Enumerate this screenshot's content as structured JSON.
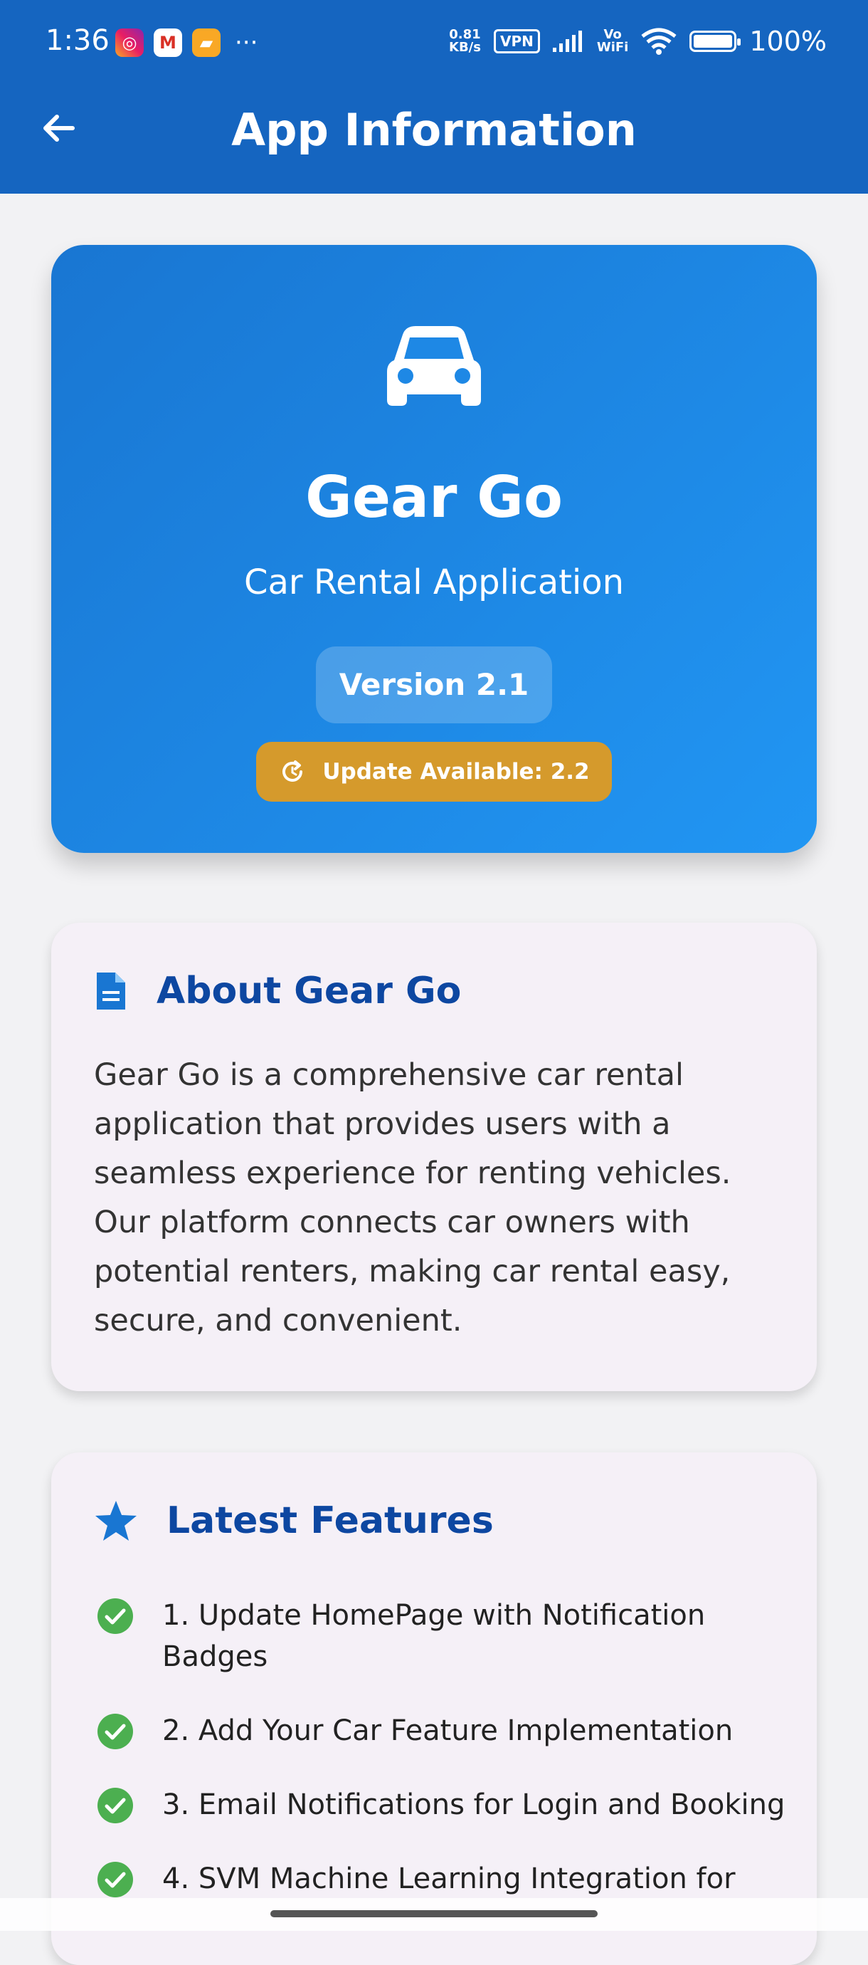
{
  "status_bar": {
    "time": "1:36",
    "net_speed_value": "0.81",
    "net_speed_unit": "KB/s",
    "vpn": "VPN",
    "vo": "Vo",
    "wifi_label": "WiFi",
    "battery": "100%"
  },
  "app_bar": {
    "title": "App Information"
  },
  "hero": {
    "app_name": "Gear Go",
    "subtitle": "Car Rental Application",
    "version": "Version 2.1",
    "update": "Update Available: 2.2"
  },
  "about": {
    "title": "About Gear Go",
    "body": "Gear Go is a comprehensive car rental application that provides users with a seamless experience for renting vehicles. Our platform connects car owners with potential renters, making car rental easy, secure, and convenient."
  },
  "features": {
    "title": "Latest Features",
    "items": [
      "1. Update HomePage with Notification Badges",
      "2. Add Your Car Feature Implementation",
      "3. Email Notifications for Login and Booking",
      "4. SVM Machine Learning Integration for"
    ]
  },
  "colors": {
    "primary": "#1565c0",
    "accent_gold": "#d59a2c",
    "heading_blue": "#0d47a1",
    "check_green": "#4caf50"
  }
}
